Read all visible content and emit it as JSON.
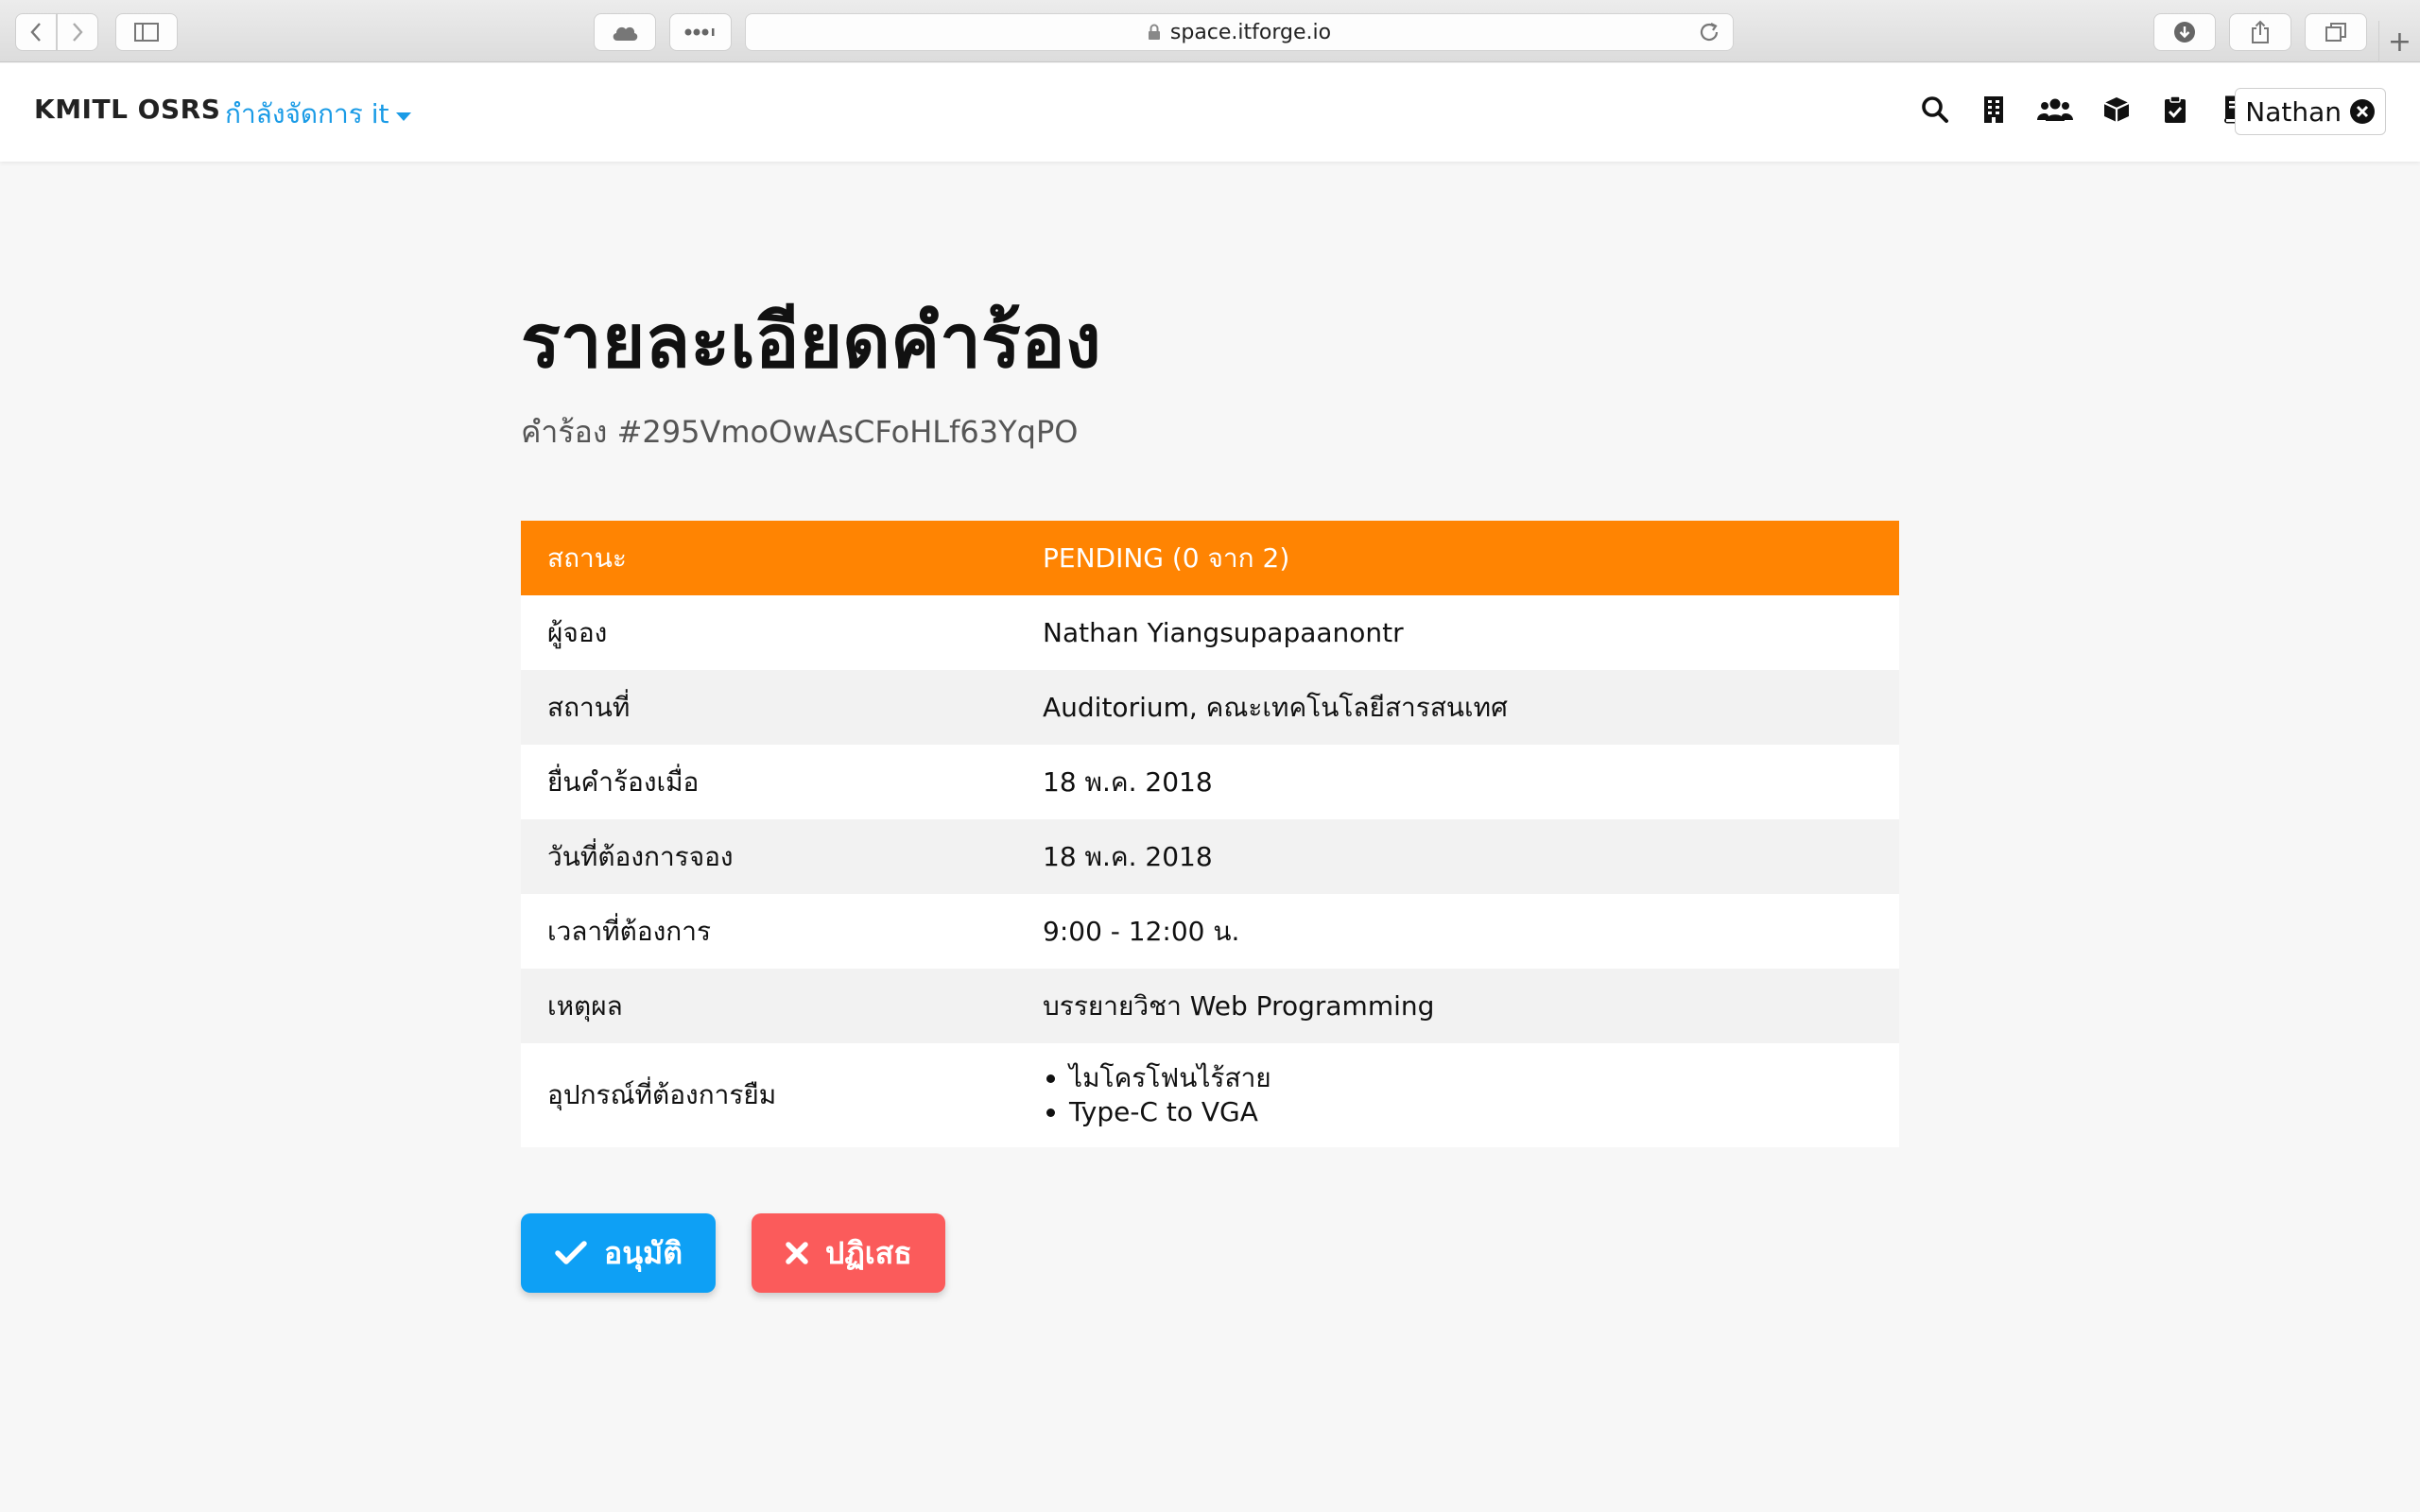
{
  "browser": {
    "url": "space.itforge.io"
  },
  "navbar": {
    "brand": "KMITL OSRS",
    "manage_label": "กำลังจัดการ it",
    "icons": [
      "search-icon",
      "building-icon",
      "users-icon",
      "box-icon",
      "clipboard-check-icon",
      "book-icon"
    ],
    "user_name": "Nathan"
  },
  "page": {
    "title": "รายละเอียดคำร้อง",
    "subtitle": "คำร้อง #295VmoOwAsCFoHLf63YqPO"
  },
  "details": {
    "status": {
      "label": "สถานะ",
      "value": "PENDING (0 จาก 2)"
    },
    "booker": {
      "label": "ผู้จอง",
      "value": "Nathan Yiangsupapaanontr"
    },
    "place": {
      "label": "สถานที่",
      "value": "Auditorium, คณะเทคโนโลยีสารสนเทศ"
    },
    "submitted": {
      "label": "ยื่นคำร้องเมื่อ",
      "value": "18 พ.ค. 2018"
    },
    "date": {
      "label": "วันที่ต้องการจอง",
      "value": "18 พ.ค. 2018"
    },
    "time": {
      "label": "เวลาที่ต้องการ",
      "value": "9:00 - 12:00 น."
    },
    "reason": {
      "label": "เหตุผล",
      "value": "บรรยายวิชา Web Programming"
    },
    "equipment": {
      "label": "อุปกรณ์ที่ต้องการยืม",
      "items": [
        "ไมโครโฟนไร้สาย",
        "Type-C to VGA"
      ]
    }
  },
  "actions": {
    "approve": "อนุมัติ",
    "reject": "ปฏิเสธ"
  },
  "colors": {
    "status_header": "#ff8402",
    "approve": "#0ea0f5",
    "reject": "#fb5b5b",
    "accent": "#1a9be6"
  }
}
